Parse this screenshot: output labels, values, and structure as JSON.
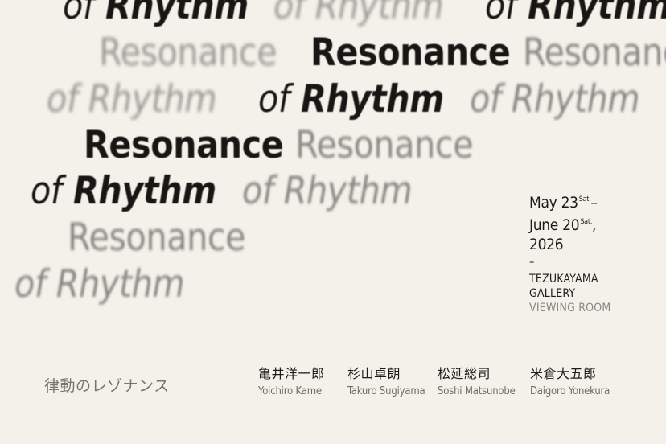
{
  "title_words": {
    "resonance": "Resonance",
    "of": "of",
    "rhythm": "Rhythm"
  },
  "dates": {
    "start": "May 23",
    "start_day": "Sat.",
    "start_sep": "–",
    "end": "June 20",
    "end_day": "Sat.",
    "end_sep": ",",
    "year": "2026",
    "dash": "–"
  },
  "venue": {
    "line1": "TEZUKAYAMA",
    "line2": "GALLERY",
    "line3": "VIEWING ROOM"
  },
  "japanese_title": "律動のレゾナンス",
  "artists": [
    {
      "jp": "亀井洋一郎",
      "en": "Yoichiro Kamei"
    },
    {
      "jp": "杉山卓朗",
      "en": "Takuro Sugiyama"
    },
    {
      "jp": "松延総司",
      "en": "Soshi Matsunobe"
    },
    {
      "jp": "米倉大五郎",
      "en": "Daigoro Yonekura"
    }
  ],
  "colors": {
    "background": "#f3f1e9",
    "text_dark": "#1d1c19",
    "text_grey": "#8a8884"
  }
}
